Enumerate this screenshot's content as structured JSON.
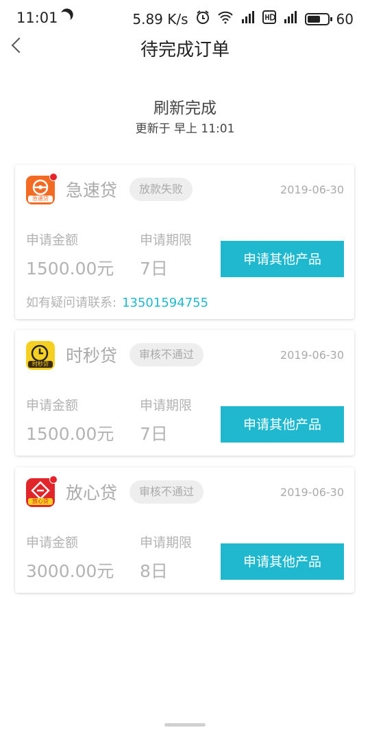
{
  "status_bar": {
    "time": "11:01",
    "speed": "5.89 K/s",
    "battery": "60"
  },
  "header": {
    "title": "待完成订单"
  },
  "refresh": {
    "title": "刷新完成",
    "subtitle": "更新于 早上 11:01"
  },
  "orders": [
    {
      "name": "急速贷",
      "status": "放款失败",
      "date": "2019-06-30",
      "amount_label": "申请金额",
      "amount": "1500.00元",
      "term_label": "申请期限",
      "term": "7日",
      "button": "申请其他产品",
      "contact_label": "如有疑问请联系:",
      "contact_phone": "13501594755",
      "logo_text": "急速贷",
      "logo_color": "#f36a22"
    },
    {
      "name": "时秒贷",
      "status": "审核不通过",
      "date": "2019-06-30",
      "amount_label": "申请金额",
      "amount": "1500.00元",
      "term_label": "申请期限",
      "term": "7日",
      "button": "申请其他产品",
      "logo_text": "时秒贷",
      "logo_color": "#f5cf22"
    },
    {
      "name": "放心贷",
      "status": "审核不通过",
      "date": "2019-06-30",
      "amount_label": "申请金额",
      "amount": "3000.00元",
      "term_label": "申请期限",
      "term": "8日",
      "button": "申请其他产品",
      "logo_text": "放心贷",
      "logo_color": "#e1262b"
    }
  ],
  "colors": {
    "accent": "#1fb8ce",
    "muted": "#b3b3b3"
  }
}
